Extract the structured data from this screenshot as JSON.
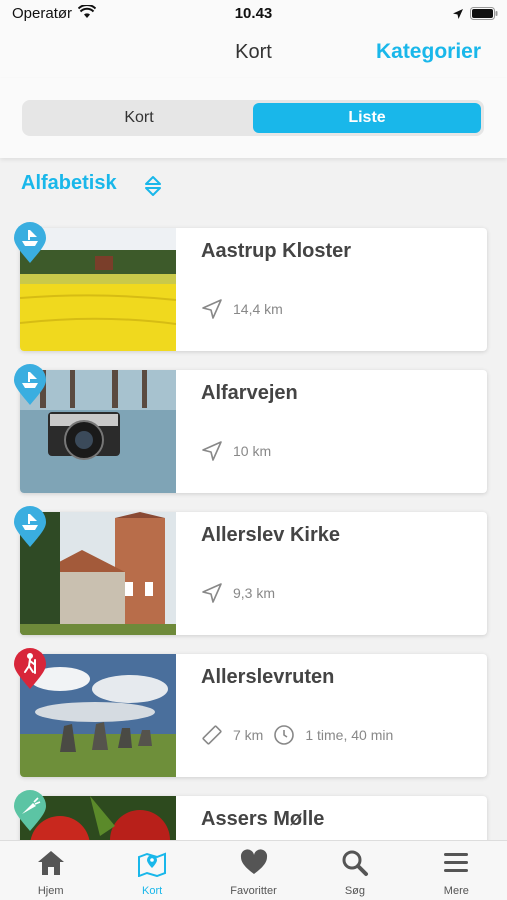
{
  "status": {
    "carrier": "Operatør",
    "time": "10.43"
  },
  "nav": {
    "title": "Kort",
    "right_action": "Kategorier"
  },
  "segment": {
    "left": "Kort",
    "right": "Liste",
    "selected": "Liste"
  },
  "sort": {
    "label": "Alfabetisk"
  },
  "items": [
    {
      "title": "Aastrup Kloster",
      "distance": "14,4 km",
      "category_icon": "ship-icon",
      "pin_color": "#3aaee0",
      "image": "rapeseed-field"
    },
    {
      "title": "Alfarvejen",
      "distance": "10 km",
      "category_icon": "ship-icon",
      "pin_color": "#3aaee0",
      "image": "camera-on-pier"
    },
    {
      "title": "Allerslev Kirke",
      "distance": "9,3 km",
      "category_icon": "ship-icon",
      "pin_color": "#3aaee0",
      "image": "church"
    },
    {
      "title": "Allerslevruten",
      "length": "7 km",
      "duration": "1 time, 40 min",
      "category_icon": "hiker-icon",
      "pin_color": "#d8263a",
      "image": "standing-stones"
    },
    {
      "title": "Assers Mølle",
      "category_icon": "carrot-icon",
      "pin_color": "#5cc4a4",
      "image": "red-apples"
    }
  ],
  "tabs": [
    {
      "label": "Hjem",
      "icon": "home-icon"
    },
    {
      "label": "Kort",
      "icon": "map-pin-icon",
      "active": true
    },
    {
      "label": "Favoritter",
      "icon": "heart-icon"
    },
    {
      "label": "Søg",
      "icon": "search-icon"
    },
    {
      "label": "Mere",
      "icon": "menu-icon"
    }
  ],
  "colors": {
    "accent": "#19b7ea",
    "blue_pin": "#3aaee0",
    "red_pin": "#d8263a",
    "green_pin": "#5cc4a4"
  }
}
